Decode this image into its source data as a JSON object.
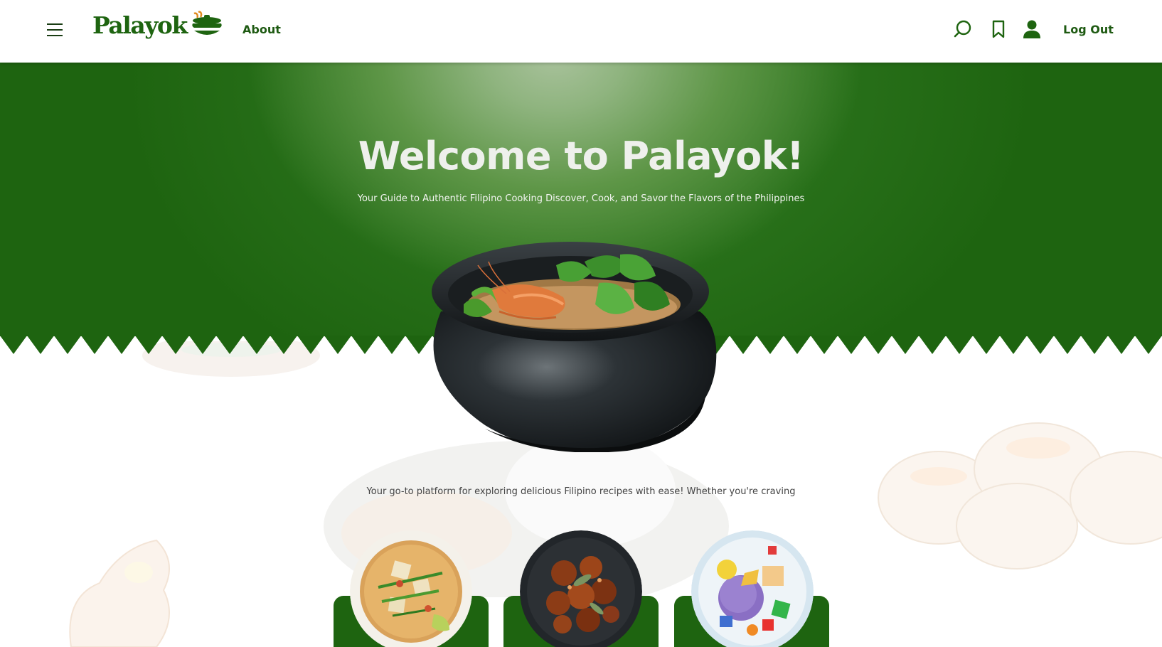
{
  "header": {
    "logo_text": "Palayok",
    "about_label": "About",
    "logout_label": "Log Out",
    "icons": [
      "menu-icon",
      "search-icon",
      "bookmark-icon",
      "user-icon"
    ]
  },
  "hero": {
    "title": "Welcome to Palayok!",
    "subtitle": "Your Guide to Authentic Filipino Cooking Discover, Cook, and Savor the Flavors of the Philippines"
  },
  "intro": {
    "text": "Your go-to platform for exploring delicious Filipino recipes with ease! Whether you're craving"
  },
  "colors": {
    "brand_green": "#1e6410",
    "text_green": "#1e5a12",
    "hero_text": "#eef0ec"
  }
}
